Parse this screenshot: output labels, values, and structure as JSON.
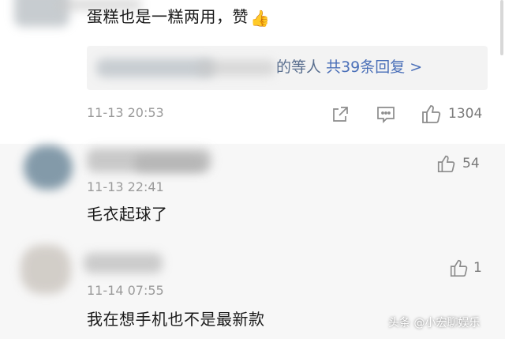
{
  "comments": [
    {
      "text": "蛋糕也是一糕两用，赞",
      "emoji": "👍",
      "replies_summary": {
        "prefix": "的等人",
        "label": "共39条回复 >"
      },
      "time": "11-13 20:53",
      "likes": "1304",
      "actions": [
        "share-icon",
        "reply-icon",
        "like-icon"
      ]
    },
    {
      "time": "11-13 22:41",
      "text": "毛衣起球了",
      "likes": "54"
    },
    {
      "time": "11-14 07:55",
      "text": "我在想手机也不是最新款",
      "likes": "1"
    }
  ],
  "watermark": "头条 @小宏聊娱乐",
  "colors": {
    "link": "#4a6fb8",
    "meta": "#9a9a9a",
    "gray_bg": "#f7f7f7",
    "reply_bg": "#f3f3f3"
  }
}
